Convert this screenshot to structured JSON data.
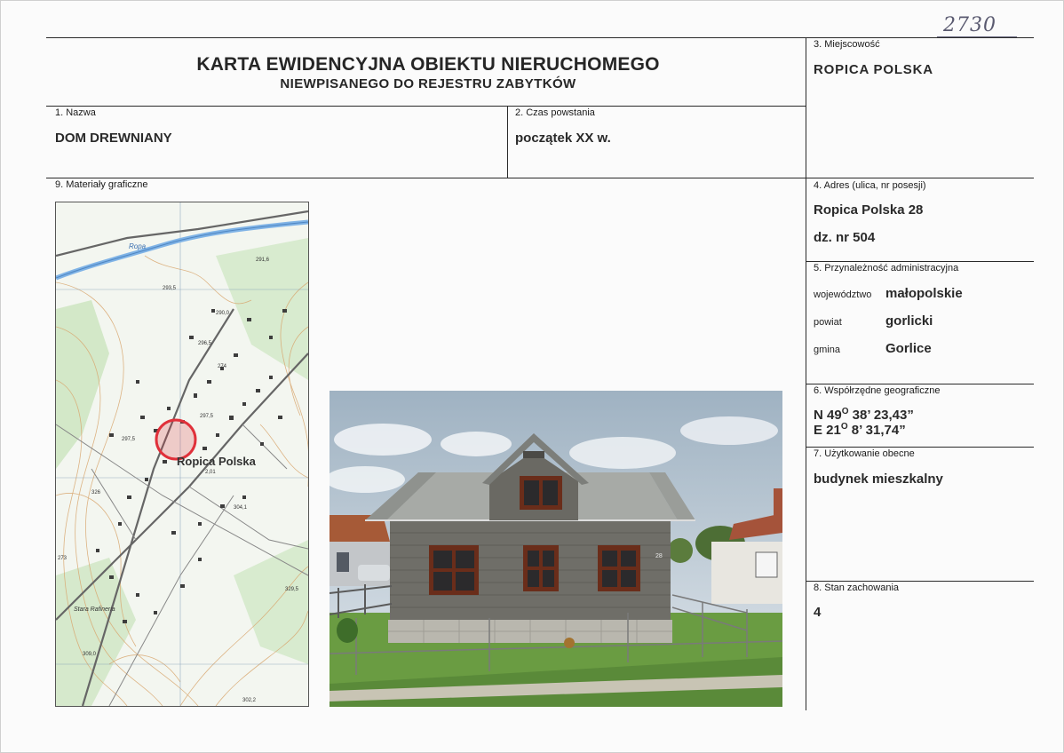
{
  "archive_number": "2730",
  "header": {
    "title": "KARTA EWIDENCYJNA OBIEKTU NIERUCHOMEGO",
    "subtitle": "NIEWPISANEGO DO REJESTRU ZABYTKÓW"
  },
  "fields": {
    "nazwa": {
      "label": "1. Nazwa",
      "value": "DOM DREWNIANY"
    },
    "czas_powstania": {
      "label": "2. Czas powstania",
      "value": "początek XX w."
    },
    "miejscowosc": {
      "label": "3. Miejscowość",
      "value": "ROPICA POLSKA"
    },
    "adres": {
      "label": "4. Adres (ulica, nr posesji)",
      "line1": "Ropica Polska 28",
      "line2": "dz. nr 504"
    },
    "przynaleznosc": {
      "label": "5. Przynależność administracyjna",
      "rows": [
        {
          "key": "województwo",
          "value": "małopolskie"
        },
        {
          "key": "powiat",
          "value": "gorlicki"
        },
        {
          "key": "gmina",
          "value": "Gorlice"
        }
      ]
    },
    "wspolrzedne": {
      "label": "6. Współrzędne geograficzne",
      "n_prefix": "N 49",
      "n_deg": "O",
      "n_rest": " 38’ 23,43”",
      "e_prefix": "E 21",
      "e_deg": "O",
      "e_rest": " 8’ 31,74”"
    },
    "uzytkowanie": {
      "label": "7. Użytkowanie obecne",
      "value": "budynek mieszkalny"
    },
    "stan": {
      "label": "8. Stan zachowania",
      "value": "4"
    },
    "materialy": {
      "label": "9. Materiały graficzne"
    }
  },
  "map": {
    "place_label": "Ropica Polska",
    "river_label": "Ropa",
    "locality_label": "Stara Rafineria",
    "elevations": [
      "291,6",
      "293,5",
      "290,0",
      "296,5",
      "274",
      "297,5",
      "297,5",
      "2,01",
      "304,1",
      "329,5",
      "309,0",
      "302,2",
      "273",
      "326"
    ],
    "colors": {
      "contour": "#d7a46a",
      "road": "#6b6b6b",
      "water": "#7fb3e6",
      "marker": "#e0303a",
      "forest": "#cfe6c4"
    }
  },
  "photo": {
    "house_number": "28",
    "colors": {
      "sky": "#c9d6df",
      "roof": "#a7aaa6",
      "wall": "#6f6e68",
      "grass": "#6a9c42",
      "window": "#6a2d1a"
    }
  }
}
